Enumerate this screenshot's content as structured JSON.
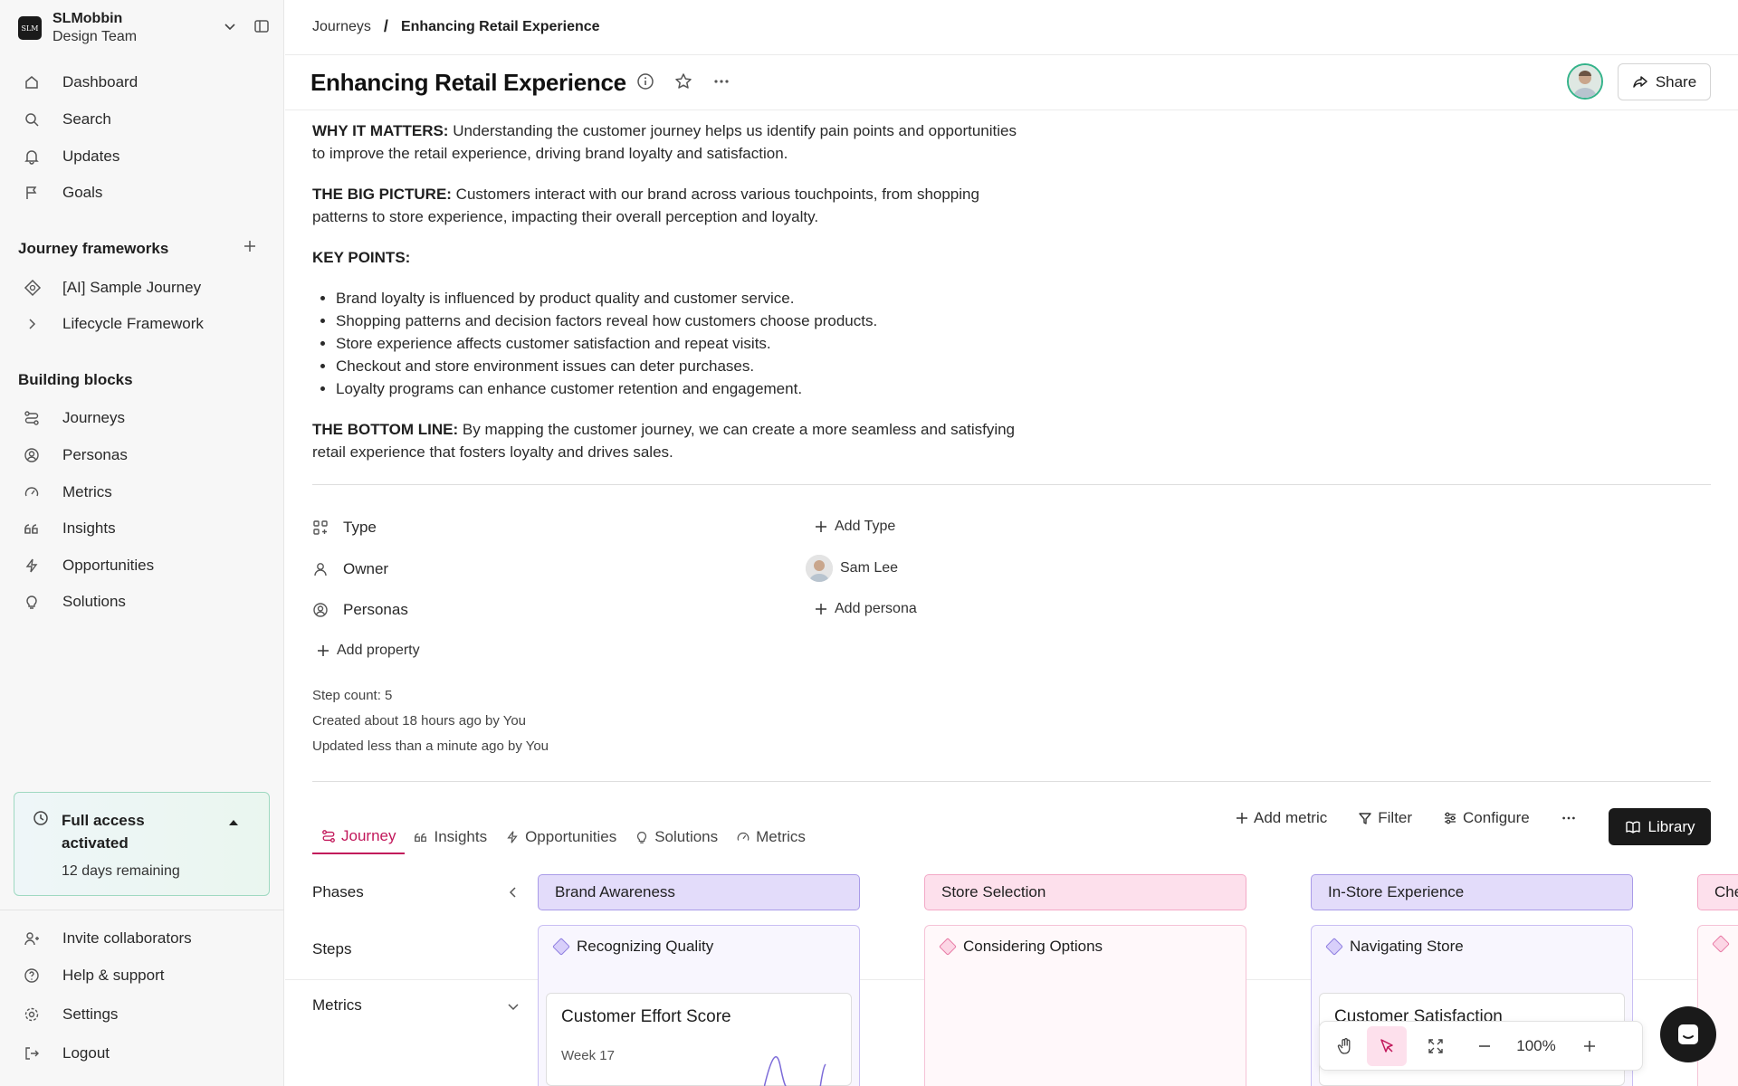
{
  "workspace": {
    "logo_text": "SLM",
    "name": "SLMobbin",
    "team": "Design Team"
  },
  "nav": [
    {
      "label": "Dashboard",
      "icon": "home-icon"
    },
    {
      "label": "Search",
      "icon": "search-icon"
    },
    {
      "label": "Updates",
      "icon": "bell-icon"
    },
    {
      "label": "Goals",
      "icon": "flag-icon"
    }
  ],
  "frameworks": {
    "title": "Journey frameworks",
    "items": [
      {
        "label": "[AI] Sample Journey",
        "icon": "ai-journey-icon"
      },
      {
        "label": "Lifecycle Framework",
        "icon": "chevron-right-icon"
      }
    ]
  },
  "blocks": {
    "title": "Building blocks",
    "items": [
      {
        "label": "Journeys",
        "icon": "journey-icon"
      },
      {
        "label": "Personas",
        "icon": "persona-icon"
      },
      {
        "label": "Metrics",
        "icon": "gauge-icon"
      },
      {
        "label": "Insights",
        "icon": "quote-icon"
      },
      {
        "label": "Opportunities",
        "icon": "bolt-icon"
      },
      {
        "label": "Solutions",
        "icon": "bulb-icon"
      }
    ]
  },
  "trial": {
    "title": "Full access activated",
    "remaining": "12 days remaining"
  },
  "footer_nav": [
    {
      "label": "Invite collaborators",
      "icon": "user-plus-icon"
    },
    {
      "label": "Help & support",
      "icon": "help-icon"
    },
    {
      "label": "Settings",
      "icon": "gear-icon"
    },
    {
      "label": "Logout",
      "icon": "logout-icon"
    }
  ],
  "breadcrumb": {
    "parent": "Journeys",
    "separator": "/",
    "current": "Enhancing Retail Experience"
  },
  "page": {
    "title": "Enhancing Retail Experience",
    "share_label": "Share"
  },
  "doc": {
    "why_label": "WHY IT MATTERS:",
    "why_text": " Understanding the customer journey helps us identify pain points and opportunities to improve the retail experience, driving brand loyalty and satisfaction.",
    "big_label": "THE BIG PICTURE:",
    "big_text": " Customers interact with our brand across various touchpoints, from shopping patterns to store experience, impacting their overall perception and loyalty.",
    "key_label": "KEY POINTS:",
    "key_points": [
      "Brand loyalty is influenced by product quality and customer service.",
      "Shopping patterns and decision factors reveal how customers choose products.",
      "Store experience affects customer satisfaction and repeat visits.",
      "Checkout and store environment issues can deter purchases.",
      "Loyalty programs can enhance customer retention and engagement."
    ],
    "bottom_label": "THE BOTTOM LINE:",
    "bottom_text": " By mapping the customer journey, we can create a more seamless and satisfying retail experience that fosters loyalty and drives sales."
  },
  "properties": {
    "type_label": "Type",
    "type_action": "Add Type",
    "owner_label": "Owner",
    "owner_value": "Sam Lee",
    "personas_label": "Personas",
    "personas_action": "Add persona",
    "add_property": "Add property"
  },
  "meta": {
    "step_count": "Step count: 5",
    "created": "Created about 18 hours ago by You",
    "updated": "Updated less than a minute ago by You"
  },
  "tabs": [
    "Journey",
    "Insights",
    "Opportunities",
    "Solutions",
    "Metrics"
  ],
  "toolbar": {
    "add_metric": "Add metric",
    "filter": "Filter",
    "configure": "Configure",
    "library": "Library"
  },
  "rows": {
    "phases": "Phases",
    "steps": "Steps",
    "metrics": "Metrics"
  },
  "phases": [
    {
      "label": "Brand Awareness",
      "step": "Recognizing Quality",
      "metric": "Customer Effort Score",
      "metric_sub": "Week 17"
    },
    {
      "label": "Store Selection",
      "step": "Considering Options"
    },
    {
      "label": "In-Store Experience",
      "step": "Navigating Store",
      "metric": "Customer Satisfaction"
    },
    {
      "label": "Che"
    }
  ],
  "zoom": {
    "level": "100%"
  },
  "colors": {
    "accent": "#c2185b",
    "purple_phase": "#e3dcfa",
    "pink_phase": "#fde0ec",
    "trial_border": "#9fd9c1"
  }
}
